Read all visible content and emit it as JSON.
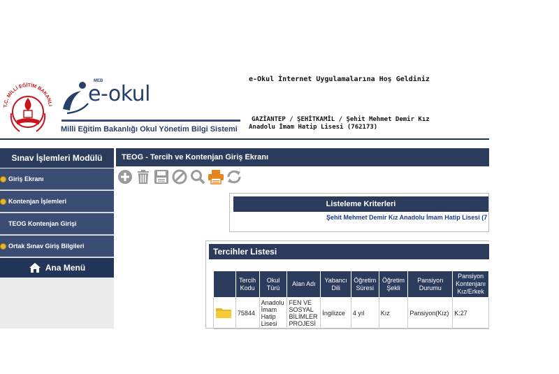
{
  "header": {
    "logo_small": "MEB",
    "logo_text": "e-okul",
    "system_title": "Milli Eğitim Bakanlığı Okul Yönetim Bilgi Sistemi",
    "welcome": "e-Okul İnternet Uygulamalarına Hoş Geldiniz",
    "school_line1": "GAZİANTEP / ŞEHİTKAMİL / Şehit Mehmet Demir Kız",
    "school_line2": "Anadolu İmam Hatip Lisesi (762173)"
  },
  "sidebar": {
    "title": "Sınav İşlemleri Modülü",
    "items": [
      {
        "label": "Giriş Ekranı"
      },
      {
        "label": "Kontenjan İşlemleri"
      },
      {
        "label": "TEOG Kontenjan Girişi"
      },
      {
        "label": "Ortak Sınav Giriş Bilgileri"
      }
    ],
    "home": "Ana Menü"
  },
  "main": {
    "title": "TEOG - Tercih ve Kontenjan Giriş Ekranı",
    "toolbar": [
      "plus-icon",
      "trash-icon",
      "save-icon",
      "cancel-icon",
      "search-icon",
      "print-icon",
      "refresh-icon"
    ],
    "criteria_title": "Listeleme Kriterleri",
    "criteria_school": "Şehit Mehmet Demir Kız Anadolu İmam Hatip Lisesi (7",
    "list_title": "Tercihler Listesi",
    "table": {
      "headers": [
        "",
        "Tercih Kodu",
        "Okul Türü",
        "Alan Adı",
        "Yabancı Dili",
        "Öğretim Süresi",
        "Öğretim Şekli",
        "Pansiyon Durumu",
        "Pansiyon Kontenjanı Kız/Erkek"
      ],
      "rows": [
        [
          "",
          "75844",
          "Anadolu İmam Hatip Lisesi",
          "FEN VE SOSYAL BİLİMLER PROJESİ",
          "İngilizce",
          "4 yıl",
          "Kız",
          "Pansiyon(Kız)",
          "K:27"
        ]
      ]
    }
  },
  "colors": {
    "navy": "#2b3b5c",
    "sidebar_item": "#3b4d74",
    "bullet": "#e6b830",
    "print_orange": "#e8841c",
    "link_blue": "#1b3a8a"
  }
}
